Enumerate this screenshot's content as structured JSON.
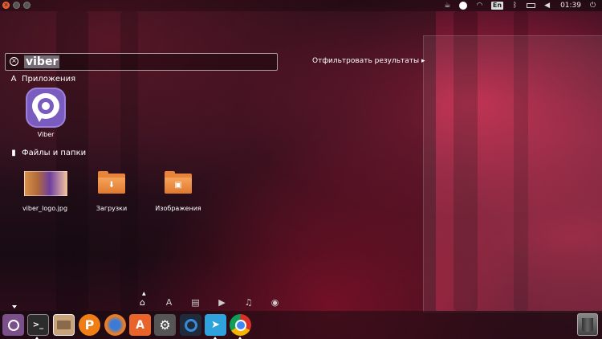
{
  "top_panel": {
    "keyboard_layout": "En",
    "clock": "01:39",
    "tray_icons": [
      "coffee-icon",
      "circle-icon",
      "wifi-icon",
      "keyboard-layout-icon",
      "bluetooth-icon",
      "battery-icon",
      "volume-icon",
      "power-icon"
    ]
  },
  "dash": {
    "search_value": "viber",
    "filter_label": "Отфильтровать результаты",
    "sections": {
      "apps": {
        "title": "Приложения",
        "items": [
          {
            "label": "Viber",
            "icon": "viber-icon"
          }
        ]
      },
      "files": {
        "title": "Файлы и папки",
        "items": [
          {
            "label": "viber_logo.jpg",
            "icon": "image-thumbnail"
          },
          {
            "label": "Загрузки",
            "icon": "downloads-folder-icon"
          },
          {
            "label": "Изображения",
            "icon": "pictures-folder-icon"
          }
        ]
      }
    },
    "lenses": [
      "home-icon",
      "applications-icon",
      "files-icon",
      "video-icon",
      "music-icon",
      "photo-icon"
    ]
  },
  "launcher": {
    "items": [
      "ubuntu-logo-icon",
      "terminal-icon",
      "files-manager-icon",
      "p-app-icon",
      "firefox-icon",
      "software-center-icon",
      "settings-icon",
      "shutter-icon",
      "telegram-icon",
      "chrome-icon"
    ],
    "trash": "trash-icon"
  },
  "colors": {
    "viber": "#7a5bbf",
    "folder": "#e8843a",
    "accent": "#e0572a"
  }
}
